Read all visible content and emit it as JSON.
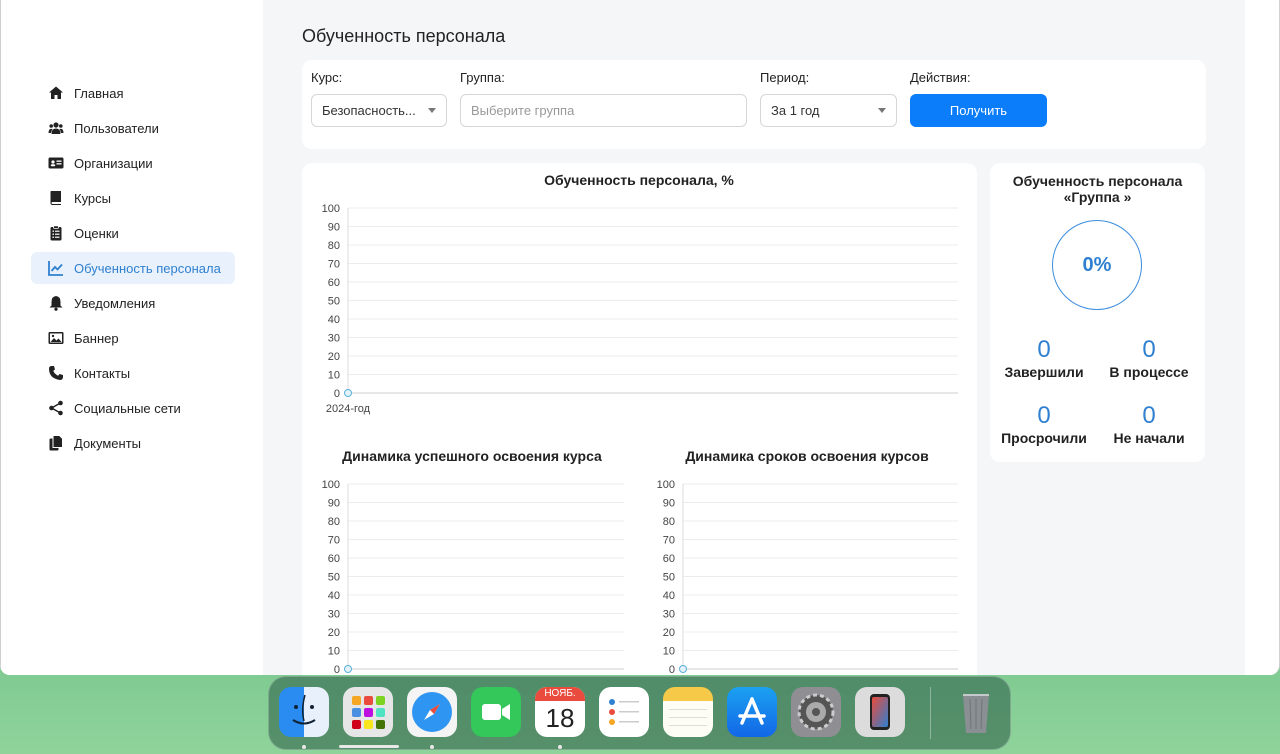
{
  "sidebar": {
    "items": [
      {
        "label": "Главная",
        "icon": "home-icon",
        "active": false
      },
      {
        "label": "Пользователи",
        "icon": "users-icon",
        "active": false
      },
      {
        "label": "Организации",
        "icon": "id-card-icon",
        "active": false
      },
      {
        "label": "Курсы",
        "icon": "book-icon",
        "active": false
      },
      {
        "label": "Оценки",
        "icon": "clipboard-icon",
        "active": false
      },
      {
        "label": "Обученность персонала",
        "icon": "chart-line-icon",
        "active": true
      },
      {
        "label": "Уведомления",
        "icon": "bell-icon",
        "active": false
      },
      {
        "label": "Баннер",
        "icon": "image-icon",
        "active": false
      },
      {
        "label": "Контакты",
        "icon": "phone-icon",
        "active": false
      },
      {
        "label": "Социальные сети",
        "icon": "share-icon",
        "active": false
      },
      {
        "label": "Документы",
        "icon": "documents-icon",
        "active": false
      }
    ]
  },
  "page": {
    "title": "Обученность персонала"
  },
  "filters": {
    "course_label": "Курс:",
    "course_value": "Безопасность...",
    "group_label": "Группа:",
    "group_placeholder": "Выберите группа",
    "period_label": "Период:",
    "period_value": "За 1 год",
    "actions_label": "Действия:",
    "submit_label": "Получить"
  },
  "colors": {
    "accent": "#0b7dfa",
    "accent_text": "#2f80d0",
    "active_bg": "#e8f1fc"
  },
  "chart_data": [
    {
      "type": "line",
      "title": "Обученность персонала, %",
      "categories": [
        "2024-год"
      ],
      "series": [
        {
          "values": [
            0
          ]
        }
      ],
      "ylim": [
        0,
        100
      ],
      "yticks": [
        0,
        10,
        20,
        30,
        40,
        50,
        60,
        70,
        80,
        90,
        100
      ],
      "grid": true
    },
    {
      "type": "line",
      "title": "Динамика успешного освоения курса",
      "categories": [
        ""
      ],
      "series": [
        {
          "values": [
            0
          ]
        }
      ],
      "ylim": [
        0,
        100
      ],
      "yticks": [
        0,
        10,
        20,
        30,
        40,
        50,
        60,
        70,
        80,
        90,
        100
      ],
      "grid": true
    },
    {
      "type": "line",
      "title": "Динамика сроков освоения курсов",
      "categories": [
        ""
      ],
      "series": [
        {
          "values": [
            0
          ]
        }
      ],
      "ylim": [
        0,
        100
      ],
      "yticks": [
        0,
        10,
        20,
        30,
        40,
        50,
        60,
        70,
        80,
        90,
        100
      ],
      "grid": true
    }
  ],
  "summary": {
    "title_line1": "Обученность персонала",
    "title_line2": "«Группа »",
    "percent": "0%",
    "completed_value": "0",
    "completed_label": "Завершили",
    "in_progress_value": "0",
    "in_progress_label": "В процессе",
    "overdue_value": "0",
    "overdue_label": "Просрочили",
    "not_started_value": "0",
    "not_started_label": "Не начали"
  },
  "dock": {
    "apps": [
      "finder-icon",
      "launchpad-icon",
      "safari-icon",
      "facetime-icon",
      "calendar-icon",
      "reminders-icon",
      "notes-icon",
      "app-store-icon",
      "system-settings-icon",
      "iphone-mirroring-icon",
      "trash-icon"
    ],
    "calendar_month": "НОЯБ.",
    "calendar_day": "18"
  }
}
